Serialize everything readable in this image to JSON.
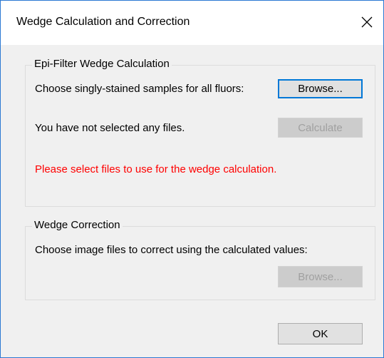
{
  "window": {
    "title": "Wedge Calculation and Correction",
    "close_label": "×"
  },
  "epi_filter": {
    "group_label": "Epi-Filter Wedge Calculation",
    "choose_label": "Choose singly-stained samples for all fluors:",
    "browse_label": "Browse...",
    "status_label": "You have not selected any files.",
    "calculate_label": "Calculate",
    "warning_text": "Please select files to use for the wedge calculation."
  },
  "wedge_correction": {
    "group_label": "Wedge Correction",
    "choose_label": "Choose image files to correct using the calculated values:",
    "browse_label": "Browse..."
  },
  "footer": {
    "ok_label": "OK"
  },
  "colors": {
    "warning": "#ff0000",
    "focus_border": "#0078d7",
    "window_border": "#2b79d3"
  }
}
